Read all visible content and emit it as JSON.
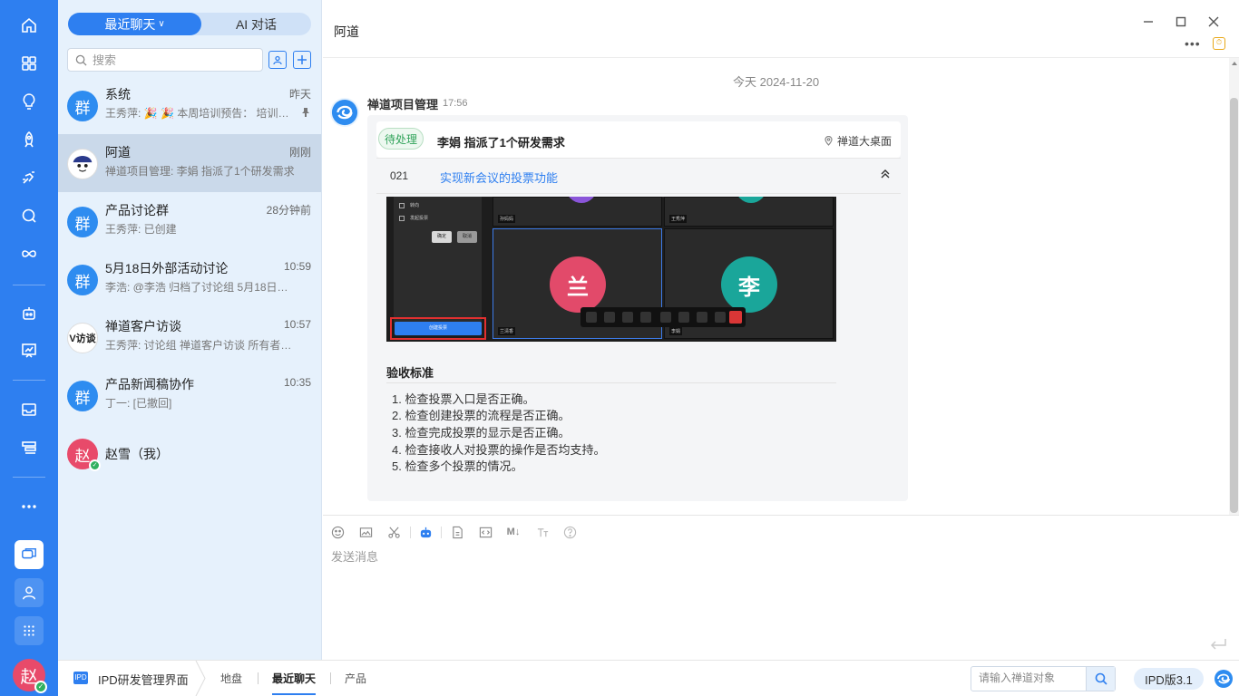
{
  "segment": {
    "recent": "最近聊天",
    "ai": "AI 对话"
  },
  "search": {
    "placeholder": "搜索"
  },
  "conversations": [
    {
      "avatar": "群",
      "name": "系统",
      "time": "昨天",
      "preview": "王秀萍: 🎉 🎉 本周培训预告： 培训主题...",
      "pinned": true
    },
    {
      "avatar": "",
      "name": "阿道",
      "time": "刚刚",
      "preview": "禅道项目管理: 李娟 指派了1个研发需求",
      "active": true
    },
    {
      "avatar": "群",
      "name": "产品讨论群",
      "time": "28分钟前",
      "preview": "王秀萍: 已创建"
    },
    {
      "avatar": "群",
      "name": "5月18日外部活动讨论",
      "time": "10:59",
      "preview": "李浩: @李浩 归档了讨论组 5月18日外部活..."
    },
    {
      "avatar": "V访谈",
      "name": "禅道客户访谈",
      "time": "10:57",
      "preview": "王秀萍: 讨论组 禅道客户访谈 所有者更..."
    },
    {
      "avatar": "群",
      "name": "产品新闻稿协作",
      "time": "10:35",
      "preview": "丁一: [已撤回]"
    },
    {
      "avatar": "赵",
      "name": "赵雪（我）",
      "time": "",
      "preview": ""
    }
  ],
  "chat": {
    "title": "阿道",
    "date_separator": "今天 2024-11-20",
    "sender": "禅道项目管理",
    "sent_time": "17:56",
    "card": {
      "status": "待处理",
      "title": "李娟 指派了1个研发需求",
      "location": "禅道大桌面",
      "req_id": "021",
      "req_title": "实现新会议的投票功能"
    },
    "screenshot": {
      "options": [
        "转向",
        "发起投票"
      ],
      "btn_ok": "确定",
      "btn_cancel": "取消",
      "primary_btn": "创建投票",
      "tiles": [
        "孙妈妈",
        "王秀萍",
        "兰清香",
        "李娟"
      ],
      "avatars": [
        "兰",
        "李"
      ]
    },
    "acceptance_title": "验收标准",
    "acceptance": [
      "1. 检查投票入口是否正确。",
      "2. 检查创建投票的流程是否正确。",
      "3. 检查完成投票的显示是否正确。",
      "4. 检查接收人对投票的操作是否均支持。",
      "5. 检查多个投票的情况。"
    ]
  },
  "composer": {
    "placeholder": "发送消息"
  },
  "bottom": {
    "app_icon": "IPD",
    "app_name": "IPD研发管理界面",
    "tabs": [
      "地盘",
      "最近聊天",
      "产品"
    ],
    "search_placeholder": "请输入禅道对象",
    "version": "IPD版3.1"
  },
  "user": {
    "avatar": "赵"
  },
  "colors": {
    "accent": "#2e7ff0",
    "status_green": "#31a35a",
    "danger": "#e23030"
  }
}
